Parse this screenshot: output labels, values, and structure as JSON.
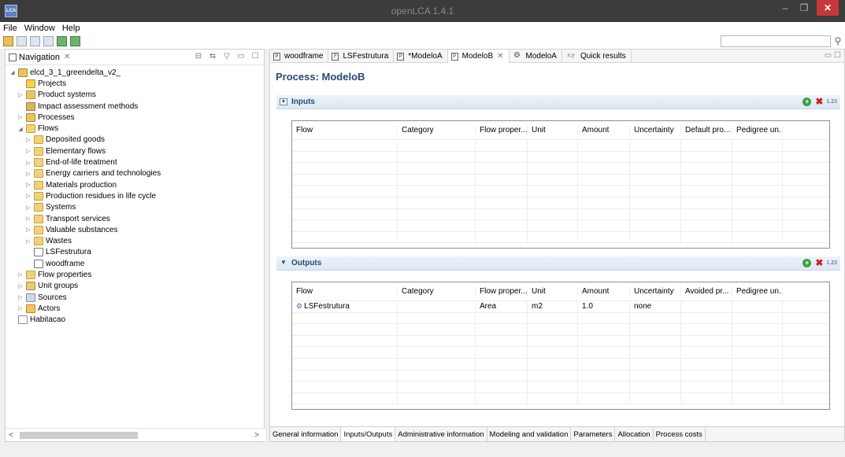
{
  "window": {
    "title": "openLCA 1.4.1",
    "app_icon": "LCA",
    "minimize": "–",
    "restore": "❐",
    "close": "✕"
  },
  "menu": {
    "file": "File",
    "window": "Window",
    "help": "Help"
  },
  "toolbar": {
    "search_placeholder": ""
  },
  "navigation": {
    "title": "Navigation",
    "tree": [
      {
        "label": "elcd_3_1_greendelta_v2_",
        "icon": "database-icon"
      },
      {
        "label": "Projects",
        "icon": "projects-folder-icon"
      },
      {
        "label": "Product systems",
        "icon": "product-systems-folder-icon"
      },
      {
        "label": "Impact assessment methods",
        "icon": "impact-methods-folder-icon"
      },
      {
        "label": "Processes",
        "icon": "processes-folder-icon"
      },
      {
        "label": "Flows",
        "icon": "flows-folder-icon"
      },
      {
        "label": "Deposited goods",
        "icon": "folder-icon"
      },
      {
        "label": "Elementary flows",
        "icon": "folder-icon"
      },
      {
        "label": "End-of-life treatment",
        "icon": "folder-icon"
      },
      {
        "label": "Energy carriers and technologies",
        "icon": "folder-icon"
      },
      {
        "label": "Materials production",
        "icon": "folder-icon"
      },
      {
        "label": "Production residues in life cycle",
        "icon": "folder-icon"
      },
      {
        "label": "Systems",
        "icon": "folder-icon"
      },
      {
        "label": "Transport services",
        "icon": "folder-icon"
      },
      {
        "label": "Valuable substances",
        "icon": "folder-icon"
      },
      {
        "label": "Wastes",
        "icon": "folder-icon"
      },
      {
        "label": "LSFestrutura",
        "icon": "flow-file-icon"
      },
      {
        "label": "woodframe",
        "icon": "flow-file-icon"
      },
      {
        "label": "Flow properties",
        "icon": "flow-properties-folder-icon"
      },
      {
        "label": "Unit groups",
        "icon": "unit-groups-folder-icon"
      },
      {
        "label": "Sources",
        "icon": "sources-folder-icon"
      },
      {
        "label": "Actors",
        "icon": "actors-folder-icon"
      },
      {
        "label": "Habitacao",
        "icon": "database-icon"
      }
    ]
  },
  "editor_tabs": [
    {
      "label": "woodframe",
      "icon": "P"
    },
    {
      "label": "LSFestrutura",
      "icon": "F"
    },
    {
      "label": "*ModeloA",
      "icon": "P"
    },
    {
      "label": "ModeloB",
      "icon": "P"
    },
    {
      "label": "ModeloA",
      "icon": "⚙"
    },
    {
      "label": "Quick results",
      "icon": "x,y"
    }
  ],
  "process": {
    "title": "Process: ModeloB"
  },
  "inputs": {
    "title": "Inputs",
    "columns": [
      "Flow",
      "Category",
      "Flow proper...",
      "Unit",
      "Amount",
      "Uncertainty",
      "Default pro...",
      "Pedigree un...",
      ""
    ],
    "rows": []
  },
  "outputs": {
    "title": "Outputs",
    "columns": [
      "Flow",
      "Category",
      "Flow proper...",
      "Unit",
      "Amount",
      "Uncertainty",
      "Avoided pr...",
      "Pedigree un...",
      ""
    ],
    "rows": [
      [
        "LSFestrutura",
        "",
        "Area",
        "m2",
        "1.0",
        "none",
        "",
        "",
        ""
      ]
    ]
  },
  "section_actions": {
    "format": "1.23"
  },
  "bottom_tabs": [
    "General information",
    "Inputs/Outputs",
    "Administrative information",
    "Modeling and validation",
    "Parameters",
    "Allocation",
    "Process costs"
  ]
}
